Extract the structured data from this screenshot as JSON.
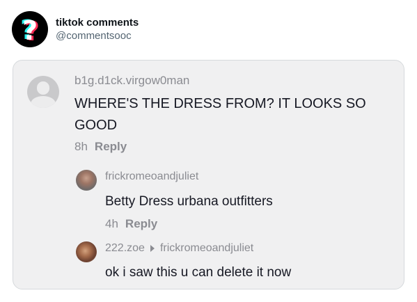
{
  "tweet": {
    "display_name": "tiktok comments",
    "handle": "@commentsooc",
    "avatar_icon": "question-mark-icon"
  },
  "comments": [
    {
      "username": "b1g.d1ck.virgow0man",
      "text": "WHERE'S THE DRESS FROM? IT LOOKS SO GOOD",
      "time": "8h",
      "reply_label": "Reply"
    },
    {
      "username": "frickromeoandjuliet",
      "text": "Betty Dress urbana outfitters",
      "time": "4h",
      "reply_label": "Reply"
    },
    {
      "username": "222.zoe",
      "reply_to": "frickromeoandjuliet",
      "text": "ok i saw this u can delete it now"
    }
  ],
  "colors": {
    "tiktok_cyan": "#25f4ee",
    "tiktok_red": "#fe2c55",
    "card_background": "#f0f0f1"
  }
}
